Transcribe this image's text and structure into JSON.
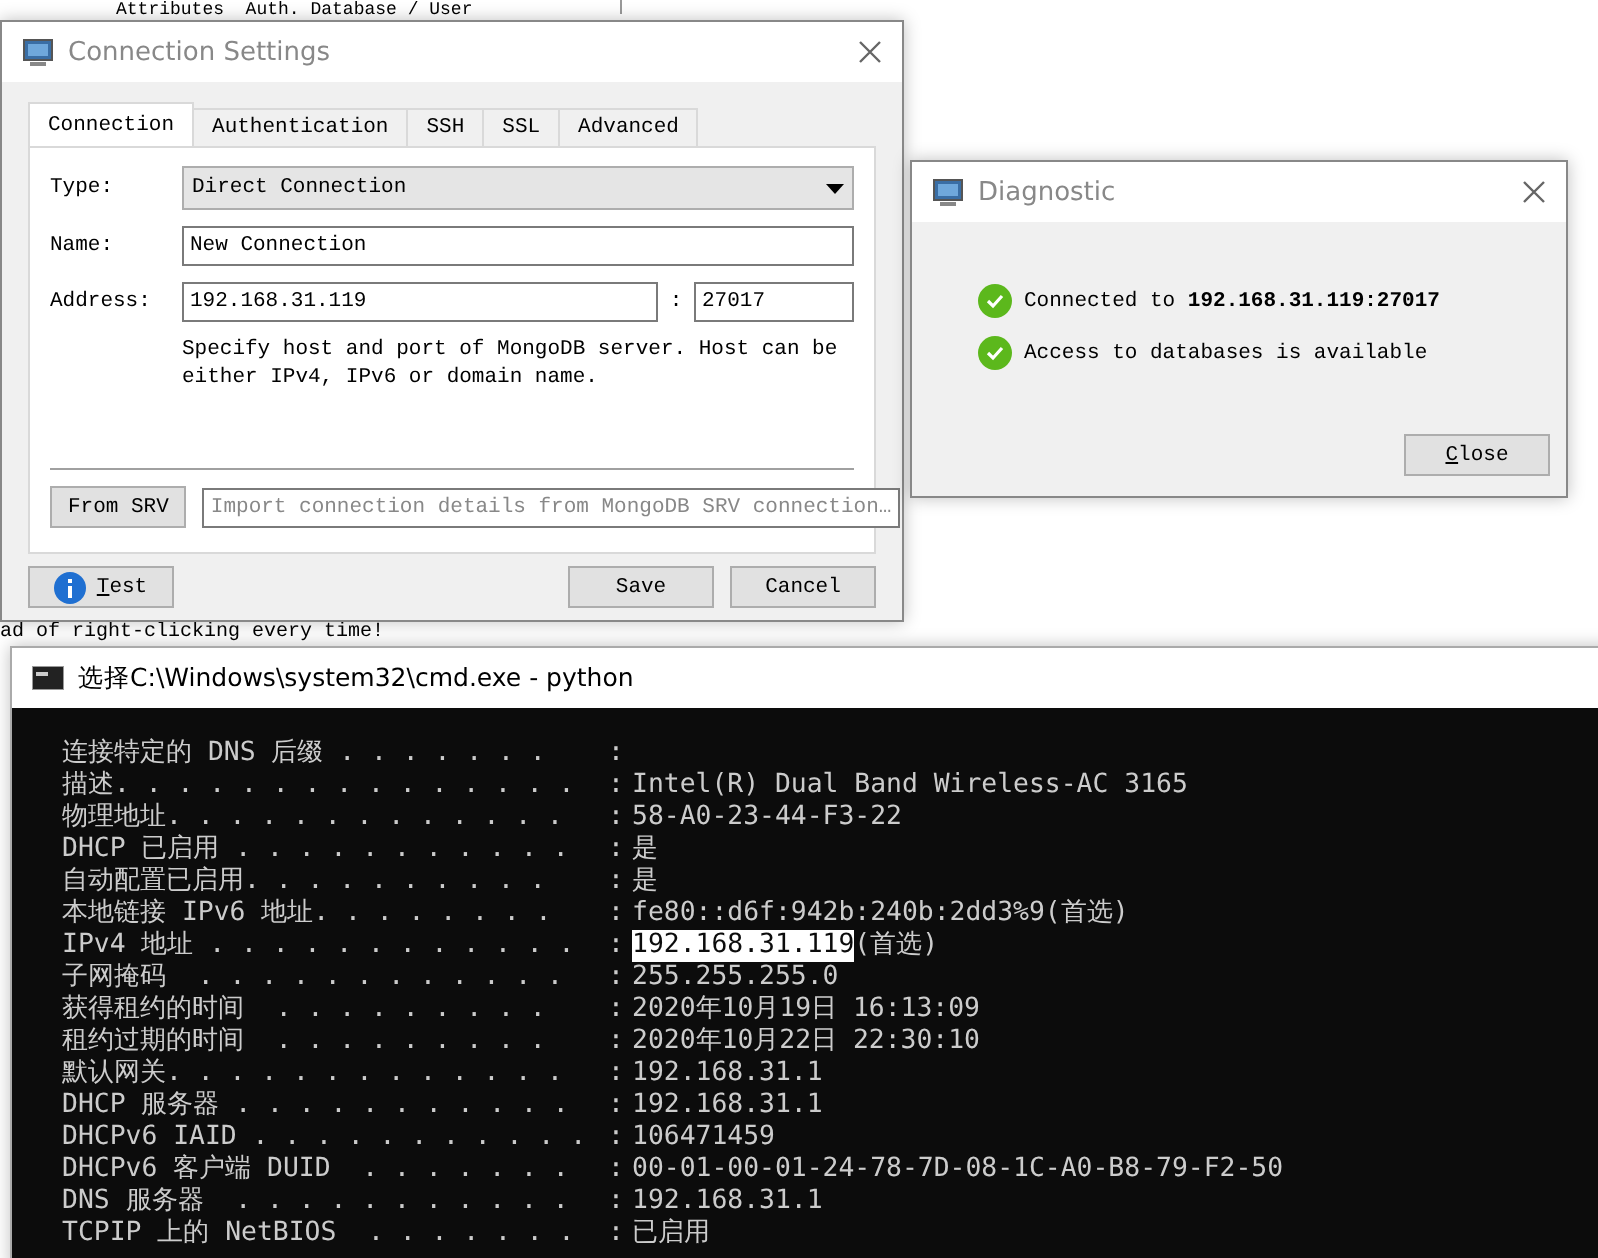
{
  "background": {
    "header_text": "Attributes  Auth. Database / User",
    "note_text": "ad of right-clicking every time!"
  },
  "connection_dialog": {
    "title": "Connection Settings",
    "tabs": [
      {
        "label": "Connection",
        "selected": true
      },
      {
        "label": "Authentication",
        "selected": false
      },
      {
        "label": "SSH",
        "selected": false
      },
      {
        "label": "SSL",
        "selected": false
      },
      {
        "label": "Advanced",
        "selected": false
      }
    ],
    "type_label": "Type:",
    "type_value": "Direct Connection",
    "name_label": "Name:",
    "name_value": "New Connection",
    "address_label": "Address:",
    "address_value": "192.168.31.119",
    "port_separator": ":",
    "port_value": "27017",
    "help_text": "Specify host and port of MongoDB server. Host can be either IPv4, IPv6 or domain name.",
    "srv_button": "From SRV",
    "srv_placeholder": "Import connection details from MongoDB SRV connection…",
    "buttons": [
      {
        "label": "Test",
        "kind": "info"
      },
      {
        "label": "Save",
        "kind": "plain"
      },
      {
        "label": "Cancel",
        "kind": "plain"
      }
    ]
  },
  "diagnostic_dialog": {
    "title": "Diagnostic",
    "messages": [
      {
        "text": "Connected to **192.168.31.119:27017**",
        "kind": "success"
      },
      {
        "text": "Access to databases is available",
        "kind": "success"
      }
    ],
    "button": "Close"
  },
  "console_window": {
    "title": "选择C:\\Windows\\system32\\cmd.exe - python",
    "rows": [
      {
        "label": "连接特定的 DNS 后缀 . . . . . . .",
        "separator": ":",
        "value": ""
      },
      {
        "label": "描述. . . . . . . . . . . . . . .",
        "separator": ":",
        "value": "Intel(R) Dual Band Wireless-AC 3165"
      },
      {
        "label": "物理地址. . . . . . . . . . . . .",
        "separator": ":",
        "value": "58-A0-23-44-F3-22"
      },
      {
        "label": "DHCP 已启用 . . . . . . . . . . .",
        "separator": ":",
        "value": "是"
      },
      {
        "label": "自动配置已启用. . . . . . . . . .",
        "separator": ":",
        "value": "是"
      },
      {
        "label": "本地链接 IPv6 地址. . . . . . . .",
        "separator": ":",
        "value": "fe80::d6f:942b:240b:2dd3%9(首选)"
      },
      {
        "label": "IPv4 地址 . . . . . . . . . . . .",
        "separator": ":",
        "selected_value": "192.168.31.119",
        "value": "(首选)"
      },
      {
        "label": "子网掩码  . . . . . . . . . . . .",
        "separator": ":",
        "value": "255.255.255.0"
      },
      {
        "label": "获得租约的时间  . . . . . . . . .",
        "separator": ":",
        "value": "2020年10月19日 16:13:09"
      },
      {
        "label": "租约过期的时间  . . . . . . . . .",
        "separator": ":",
        "value": "2020年10月22日 22:30:10"
      },
      {
        "label": "默认网关. . . . . . . . . . . . .",
        "separator": ":",
        "value": "192.168.31.1"
      },
      {
        "label": "DHCP 服务器 . . . . . . . . . . .",
        "separator": ":",
        "value": "192.168.31.1"
      },
      {
        "label": "DHCPv6 IAID . . . . . . . . . . .",
        "separator": ":",
        "value": "106471459"
      },
      {
        "label": "DHCPv6 客户端 DUID  . . . . . . .",
        "separator": ":",
        "value": "00-01-00-01-24-78-7D-08-1C-A0-B8-79-F2-50"
      },
      {
        "label": "DNS 服务器  . . . . . . . . . . .",
        "separator": ":",
        "value": "192.168.31.1"
      },
      {
        "label": "TCPIP 上的 NetBIOS  . . . . . . .",
        "separator": ":",
        "value": "已启用"
      }
    ]
  }
}
